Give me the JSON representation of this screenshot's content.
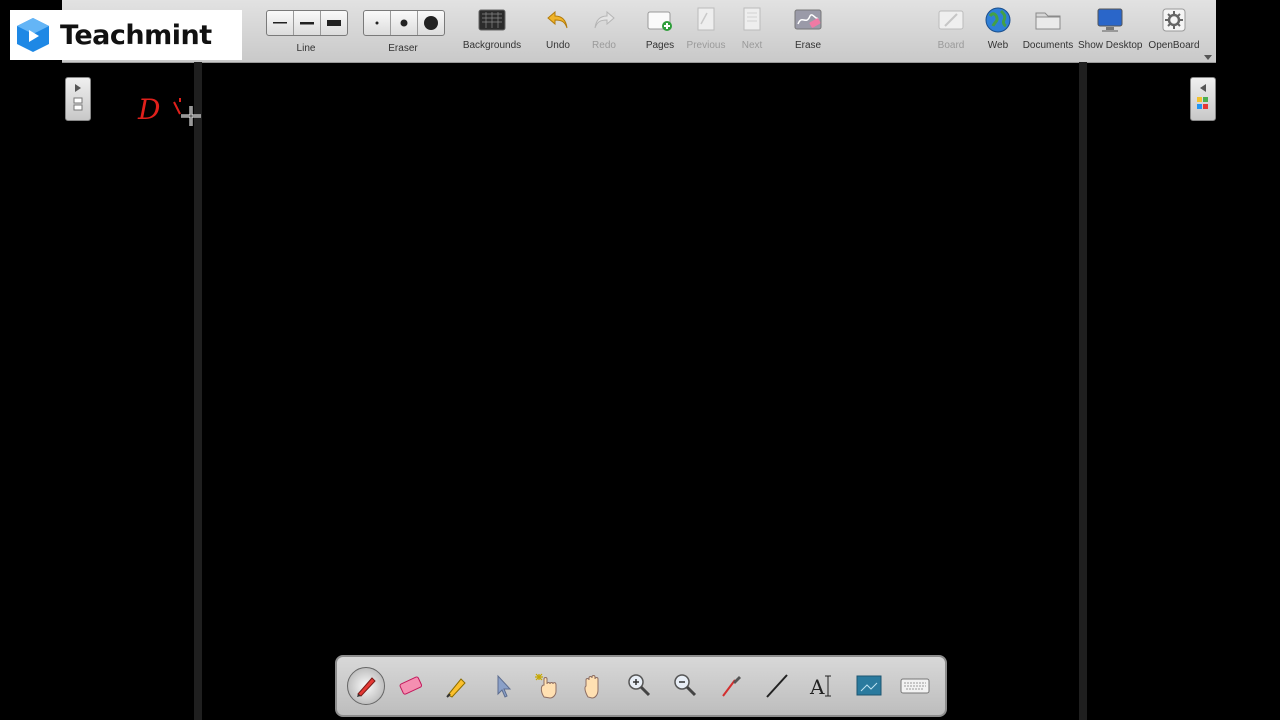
{
  "brand": {
    "name": "Teachmint"
  },
  "toolbar": {
    "line_label": "Line",
    "eraser_label": "Eraser",
    "tools": [
      {
        "id": "backgrounds",
        "label": "Backgrounds",
        "enabled": true
      },
      {
        "id": "undo",
        "label": "Undo",
        "enabled": true
      },
      {
        "id": "redo",
        "label": "Redo",
        "enabled": false
      },
      {
        "id": "pages",
        "label": "Pages",
        "enabled": true
      },
      {
        "id": "previous",
        "label": "Previous",
        "enabled": false
      },
      {
        "id": "next",
        "label": "Next",
        "enabled": false
      },
      {
        "id": "erase",
        "label": "Erase",
        "enabled": true
      },
      {
        "id": "board",
        "label": "Board",
        "enabled": false
      },
      {
        "id": "web",
        "label": "Web",
        "enabled": true
      },
      {
        "id": "documents",
        "label": "Documents",
        "enabled": true
      },
      {
        "id": "show-desktop",
        "label": "Show Desktop",
        "enabled": true
      },
      {
        "id": "openboard",
        "label": "OpenBoard",
        "enabled": true
      }
    ]
  },
  "canvas": {
    "ink_text": "D",
    "ink_color": "#e0201b"
  },
  "colors": {
    "accent": "#1e88e5",
    "toolbar_bg": "#d4d4d4",
    "board_bg": "#000000"
  },
  "stylus_palette": [
    "pen",
    "eraser",
    "marker",
    "selector",
    "interact",
    "hand",
    "zoom-in",
    "zoom-out",
    "pointer",
    "line",
    "text",
    "capture",
    "virtual-keyboard"
  ]
}
